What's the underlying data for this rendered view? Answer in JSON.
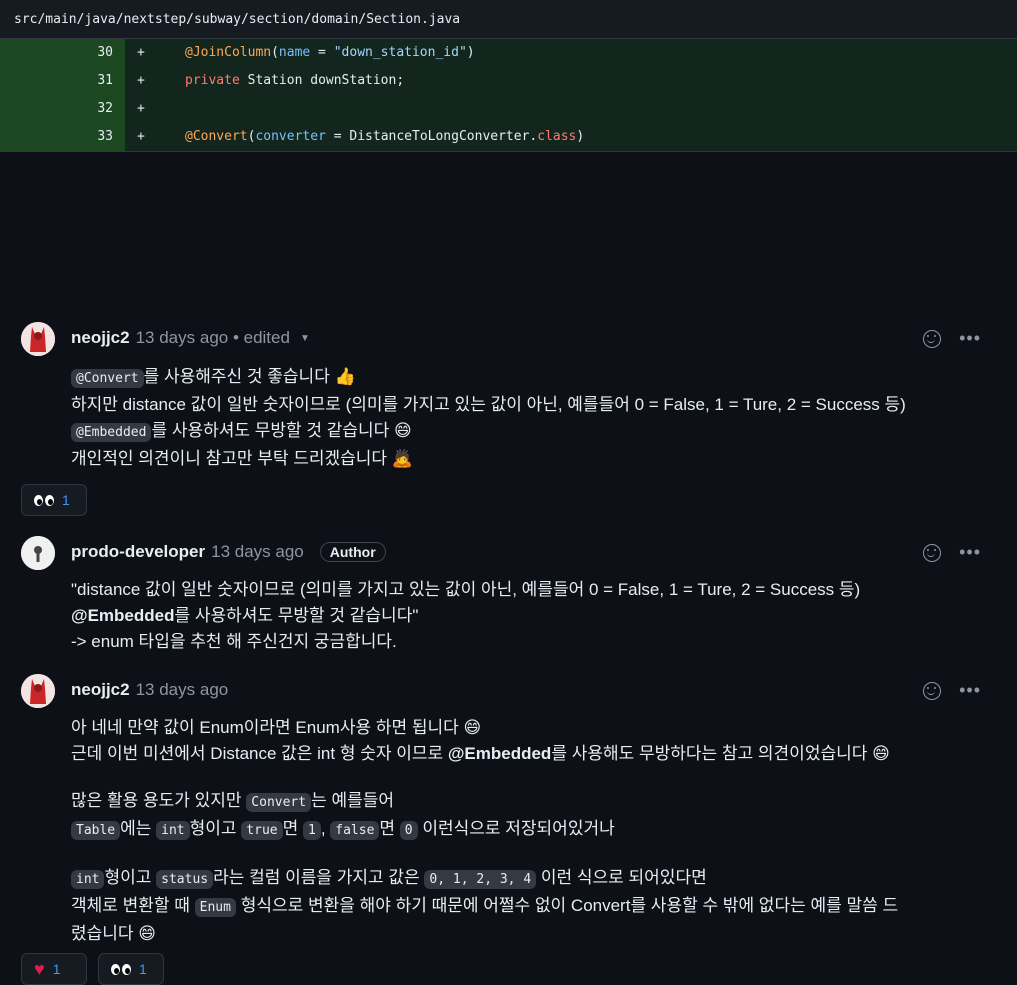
{
  "file": {
    "path": "src/main/java/nextstep/subway/section/domain/Section.java"
  },
  "diff": [
    {
      "line": "30",
      "sign": "+",
      "tokens": [
        {
          "t": "@JoinColumn",
          "c": "ann"
        },
        {
          "t": "(",
          "c": "cls"
        },
        {
          "t": "name",
          "c": "attr"
        },
        {
          "t": " = ",
          "c": "cls"
        },
        {
          "t": "\"down_station_id\"",
          "c": "str"
        },
        {
          "t": ")",
          "c": "cls"
        }
      ]
    },
    {
      "line": "31",
      "sign": "+",
      "tokens": [
        {
          "t": "private",
          "c": "kw"
        },
        {
          "t": " Station downStation;",
          "c": "cls"
        }
      ]
    },
    {
      "line": "32",
      "sign": "+",
      "tokens": []
    },
    {
      "line": "33",
      "sign": "+",
      "tokens": [
        {
          "t": "@Convert",
          "c": "ann"
        },
        {
          "t": "(",
          "c": "cls"
        },
        {
          "t": "converter",
          "c": "attr"
        },
        {
          "t": " = ",
          "c": "cls"
        },
        {
          "t": "DistanceToLongConverter",
          "c": "cls"
        },
        {
          "t": ".",
          "c": "cls"
        },
        {
          "t": "class",
          "c": "kw"
        },
        {
          "t": ")",
          "c": "cls"
        }
      ]
    }
  ],
  "comments": [
    {
      "author": "neojjc2",
      "meta": "13 days ago • edited",
      "lines": [
        [
          {
            "code": "@Convert"
          },
          {
            "text": "를 사용해주신 것 좋습니다 👍"
          }
        ],
        [
          {
            "text": "하지만 distance 값이 일반 숫자이므로 (의미를 가지고 있는 값이 아닌, 예를들어 0 = False, 1 = Ture, 2 = Success 등)"
          }
        ],
        [
          {
            "code": "@Embedded"
          },
          {
            "text": "를 사용하셔도 무방할 것 같습니다 😄"
          }
        ],
        [
          {
            "text": "개인적인 의견이니 참고만 부탁 드리겠습니다 🙇"
          }
        ]
      ],
      "reactions": [
        {
          "icon": "eyes",
          "count": "1"
        }
      ]
    },
    {
      "author": "prodo-developer",
      "meta": "13 days ago",
      "badge": "Author",
      "lines": [
        [
          {
            "text": "\"distance 값이 일반 숫자이므로 (의미를 가지고 있는 값이 아닌, 예를들어 0 = False, 1 = Ture, 2 = Success 등)"
          }
        ],
        [
          {
            "bold": "@Embedded"
          },
          {
            "text": "를 사용하셔도 무방할 것 같습니다\""
          }
        ],
        [
          {
            "text": "-> enum 타입을 추천 해 주신건지 궁금합니다."
          }
        ]
      ],
      "reactions": []
    },
    {
      "author": "neojjc2",
      "meta": "13 days ago",
      "lines": [
        [
          {
            "text": "아 네네 만약 값이 Enum이라면 Enum사용 하면 됩니다 😄"
          }
        ],
        [
          {
            "text": "근데 이번 미션에서 Distance 값은 int 형 숫자 이므로 "
          },
          {
            "bold": "@Embedded"
          },
          {
            "text": "를 사용해도 무방하다는 참고 의견이었습니다 😄"
          }
        ],
        [],
        [
          {
            "text": "많은 활용 용도가 있지만 "
          },
          {
            "code": "Convert"
          },
          {
            "text": "는 예를들어"
          }
        ],
        [
          {
            "code": "Table"
          },
          {
            "text": "에는 "
          },
          {
            "code": "int"
          },
          {
            "text": "형이고 "
          },
          {
            "code": "true"
          },
          {
            "text": "면 "
          },
          {
            "code": "1"
          },
          {
            "text": ", "
          },
          {
            "code": "false"
          },
          {
            "text": "면 "
          },
          {
            "code": "0"
          },
          {
            "text": " 이런식으로 저장되어있거나"
          }
        ],
        [],
        [
          {
            "code": "int"
          },
          {
            "text": "형이고 "
          },
          {
            "code": "status"
          },
          {
            "text": "라는 컬럼 이름을 가지고 값은 "
          },
          {
            "code": "0, 1, 2, 3, 4"
          },
          {
            "text": " 이런 식으로 되어있다면"
          }
        ],
        [
          {
            "text": "객체로 변환할 때 "
          },
          {
            "code": "Enum"
          },
          {
            "text": " 형식으로 변환을 해야 하기 때문에 어쩔수 없이 Convert를 사용할 수 밖에 없다는 예를 말씀 드"
          }
        ],
        [
          {
            "text": "렸습니다 😄"
          }
        ]
      ],
      "reactions": [
        {
          "icon": "heart",
          "count": "1"
        },
        {
          "icon": "eyes",
          "count": "1"
        }
      ]
    }
  ]
}
